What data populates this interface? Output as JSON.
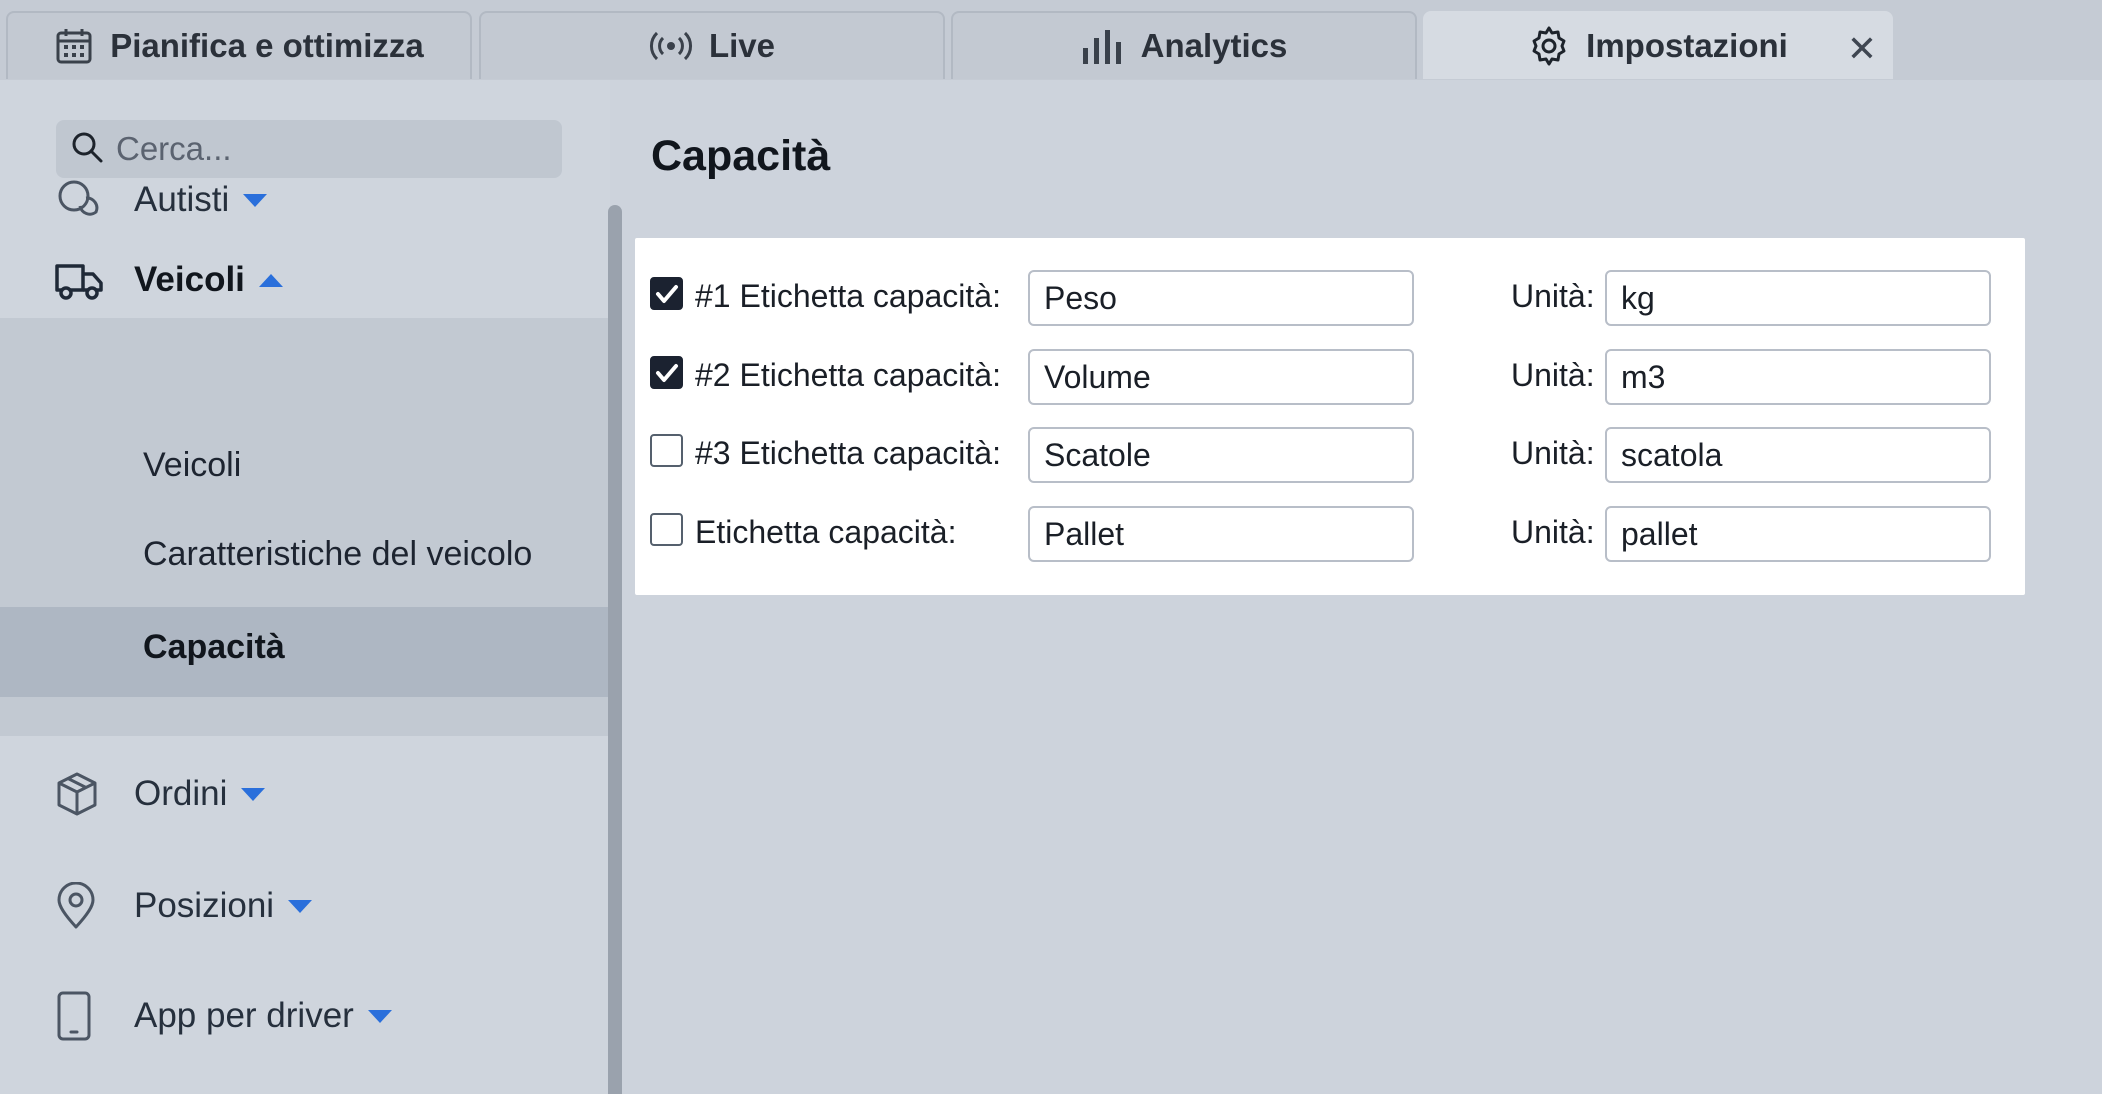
{
  "tabs": [
    {
      "label": "Pianifica e ottimizza",
      "icon": "calendar-icon"
    },
    {
      "label": "Live",
      "icon": "broadcast-icon"
    },
    {
      "label": "Analytics",
      "icon": "bar-chart-icon"
    },
    {
      "label": "Impostazioni",
      "icon": "gear-icon",
      "active": true
    }
  ],
  "tab_close": "✕",
  "search": {
    "placeholder": "Cerca..."
  },
  "sidebar": {
    "items": [
      {
        "label": "Autisti",
        "icon": "drivers-icon",
        "expanded": false
      },
      {
        "label": "Veicoli",
        "icon": "truck-icon",
        "expanded": true
      },
      {
        "label": "Ordini",
        "icon": "box-icon",
        "expanded": false
      },
      {
        "label": "Posizioni",
        "icon": "location-pin-icon",
        "expanded": false
      },
      {
        "label": "App per driver",
        "icon": "phone-icon",
        "expanded": false
      }
    ],
    "vehicle_subitems": [
      "Veicoli",
      "Caratteristiche del veicolo",
      "Capacità"
    ],
    "active_subitem": "Capacità"
  },
  "page": {
    "title": "Capacità",
    "rows": [
      {
        "checked": true,
        "label": "#1 Etichetta capacità:",
        "value": "Peso",
        "unit_label": "Unità:",
        "unit": "kg"
      },
      {
        "checked": true,
        "label": "#2 Etichetta capacità:",
        "value": "Volume",
        "unit_label": "Unità:",
        "unit": "m3"
      },
      {
        "checked": false,
        "label": "#3 Etichetta capacità:",
        "value": "Scatole",
        "unit_label": "Unità:",
        "unit": "scatola"
      },
      {
        "checked": false,
        "label": "Etichetta capacità:",
        "value": "Pallet",
        "unit_label": "Unità:",
        "unit": "pallet"
      }
    ]
  },
  "colors": {
    "accent": "#2a6fdb",
    "sidebar_active": "#aeb7c3",
    "panel": "#ffffff"
  }
}
